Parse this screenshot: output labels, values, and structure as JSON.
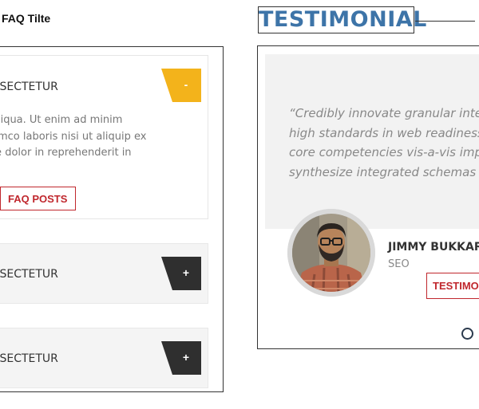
{
  "faq": {
    "title": "FAQ Tilte",
    "posts_button": "FAQ POSTS",
    "items": [
      {
        "question": "NSECTETUR",
        "toggle": "-",
        "state": "expanded",
        "toggle_color": "#f3b31b",
        "answer_lines": [
          "aliqua. Ut enim ad minim",
          "amco laboris nisi ut aliquip ex",
          "re dolor in reprehenderit in"
        ]
      },
      {
        "question": "NSECTETUR",
        "toggle": "+",
        "state": "collapsed",
        "toggle_color": "#2f2f2f"
      },
      {
        "question": "NSECTETUR",
        "toggle": "+",
        "state": "collapsed",
        "toggle_color": "#2f2f2f"
      }
    ]
  },
  "testimonial": {
    "heading": "TESTIMONIAL",
    "quote_lines": [
      "“Credibly innovate granular intern",
      "high standards in web readiness. I",
      "core competencies vis-a-vis impac",
      "synthesize integrated schemas wit"
    ],
    "author": {
      "name": "JIMMY BUKKARD",
      "role": "SEO"
    },
    "button": "TESTIMO",
    "accent_color": "#3d74a8",
    "button_color": "#c0272d"
  }
}
